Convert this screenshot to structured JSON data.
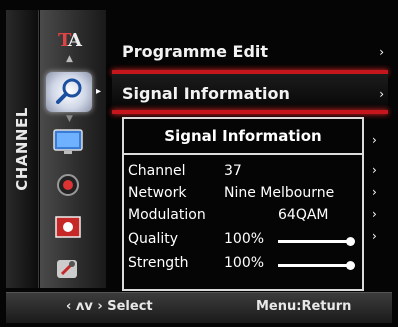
{
  "sidebar": {
    "title": "CHANNEL"
  },
  "icons": [
    {
      "name": "ta-icon"
    },
    {
      "name": "search-icon"
    },
    {
      "name": "tv-icon"
    },
    {
      "name": "record-icon"
    },
    {
      "name": "photo-icon"
    },
    {
      "name": "settings-icon"
    }
  ],
  "menu": {
    "items": [
      {
        "label": "Programme Edit",
        "chevron": "›"
      },
      {
        "label": "Signal Information",
        "chevron": "›"
      }
    ]
  },
  "popup": {
    "title": "Signal Information",
    "rows": [
      {
        "key": "Channel",
        "value": "37"
      },
      {
        "key": "Network",
        "value": "Nine Melbourne"
      },
      {
        "key": "Modulation",
        "value": "64QAM"
      },
      {
        "key": "Quality",
        "value": "100%",
        "level": 1.0
      },
      {
        "key": "Strength",
        "value": "100%",
        "level": 1.0
      }
    ]
  },
  "bottom": {
    "select_label": "‹ ʌv › Select",
    "return_label": "Menu:Return"
  },
  "colors": {
    "accent_red": "#c4161c",
    "background": "#050505"
  }
}
